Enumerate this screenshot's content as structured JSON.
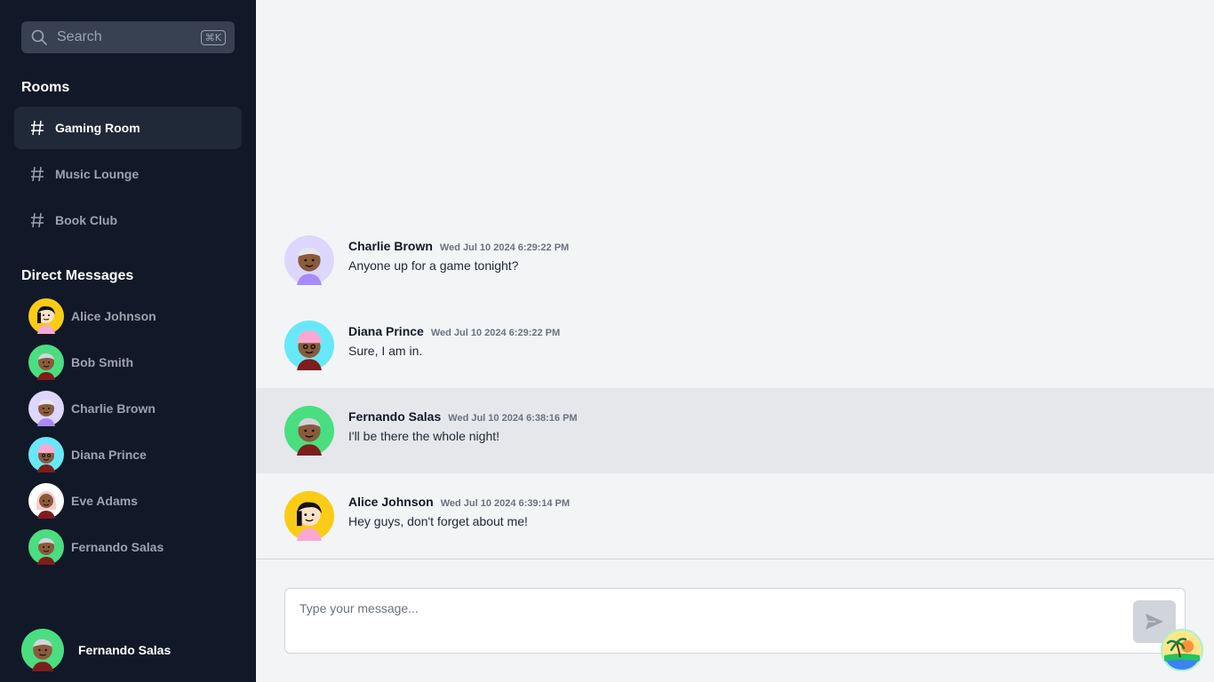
{
  "search": {
    "placeholder": "Search",
    "shortcut": "⌘K",
    "icon": "search-icon"
  },
  "rooms": {
    "title": "Rooms",
    "items": [
      {
        "label": "Gaming Room",
        "active": true
      },
      {
        "label": "Music Lounge",
        "active": false
      },
      {
        "label": "Book Club",
        "active": false
      }
    ]
  },
  "dms": {
    "title": "Direct Messages",
    "items": [
      {
        "name": "Alice Johnson"
      },
      {
        "name": "Bob Smith"
      },
      {
        "name": "Charlie Brown"
      },
      {
        "name": "Diana Prince"
      },
      {
        "name": "Eve Adams"
      },
      {
        "name": "Fernando Salas"
      }
    ]
  },
  "current_user": {
    "name": "Fernando Salas"
  },
  "messages": [
    {
      "author": "Charlie Brown",
      "time": "Wed Jul 10 2024 6:29:22 PM",
      "text": "Anyone up for a game tonight?"
    },
    {
      "author": "Diana Prince",
      "time": "Wed Jul 10 2024 6:29:22 PM",
      "text": "Sure, I am in."
    },
    {
      "author": "Fernando Salas",
      "time": "Wed Jul 10 2024 6:38:16 PM",
      "text": "I'll be there the whole night!"
    },
    {
      "author": "Alice Johnson",
      "time": "Wed Jul 10 2024 6:39:14 PM",
      "text": "Hey guys, don't forget about me!"
    }
  ],
  "composer": {
    "placeholder": "Type your message...",
    "send_icon": "send-icon"
  },
  "colors": {
    "sidebar_bg": "#111827",
    "main_bg": "#f3f4f6",
    "highlight_bg": "#e5e7eb"
  }
}
